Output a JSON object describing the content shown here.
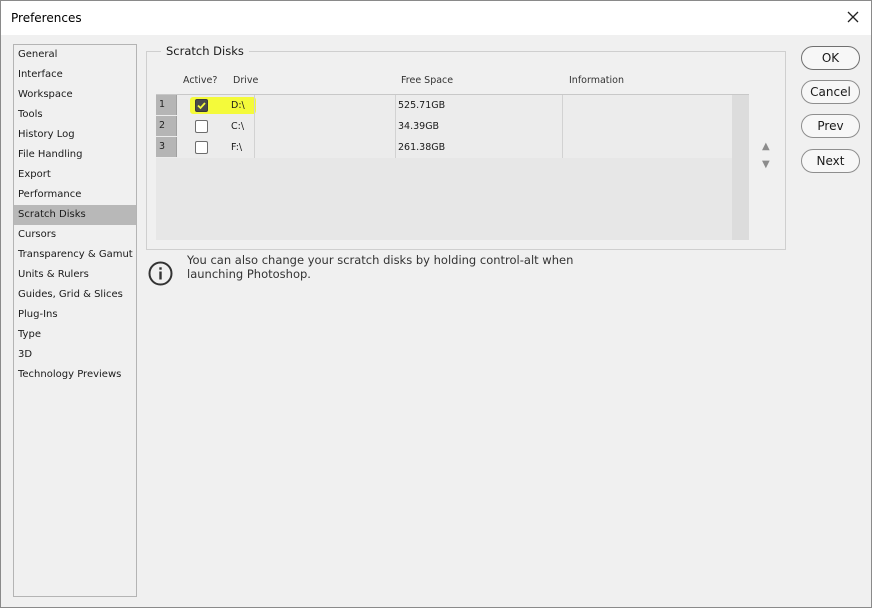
{
  "window": {
    "title": "Preferences"
  },
  "sidebar": {
    "items": [
      {
        "label": "General"
      },
      {
        "label": "Interface"
      },
      {
        "label": "Workspace"
      },
      {
        "label": "Tools"
      },
      {
        "label": "History Log"
      },
      {
        "label": "File Handling"
      },
      {
        "label": "Export"
      },
      {
        "label": "Performance"
      },
      {
        "label": "Scratch Disks"
      },
      {
        "label": "Cursors"
      },
      {
        "label": "Transparency & Gamut"
      },
      {
        "label": "Units & Rulers"
      },
      {
        "label": "Guides, Grid & Slices"
      },
      {
        "label": "Plug-Ins"
      },
      {
        "label": "Type"
      },
      {
        "label": "3D"
      },
      {
        "label": "Technology Previews"
      }
    ],
    "selected": "Scratch Disks"
  },
  "scratch": {
    "group_title": "Scratch Disks",
    "columns": {
      "active": "Active?",
      "drive": "Drive",
      "free": "Free Space",
      "info": "Information"
    },
    "rows": [
      {
        "num": "1",
        "active": true,
        "drive": "D:\\",
        "free": "525.71GB",
        "info": ""
      },
      {
        "num": "2",
        "active": false,
        "drive": "C:\\",
        "free": "34.39GB",
        "info": ""
      },
      {
        "num": "3",
        "active": false,
        "drive": "F:\\",
        "free": "261.38GB",
        "info": ""
      }
    ],
    "highlight_color": "#f4fa3a",
    "up_arrow": "▲",
    "down_arrow": "▼"
  },
  "info": {
    "icon": "info-icon",
    "text": "You can also change your scratch disks by holding control-alt when launching Photoshop."
  },
  "buttons": {
    "ok": "OK",
    "cancel": "Cancel",
    "prev": "Prev",
    "next": "Next"
  }
}
